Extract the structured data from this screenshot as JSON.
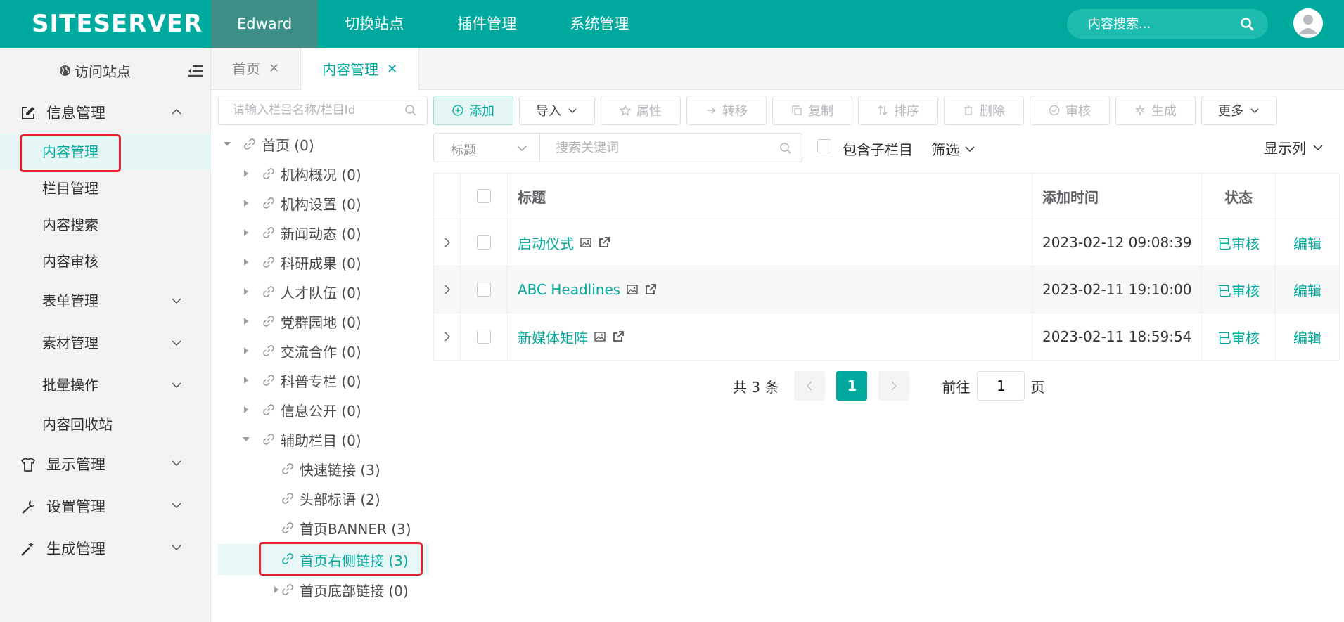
{
  "topbar": {
    "logo": "SITESERVER",
    "nav": [
      "Edward",
      "切换站点",
      "插件管理",
      "系统管理"
    ],
    "search_placeholder": "内容搜索..."
  },
  "sidebar": {
    "visit_site": "访问站点",
    "groups": {
      "info": "信息管理",
      "display": "显示管理",
      "settings": "设置管理",
      "generate": "生成管理"
    },
    "items": {
      "content_manage": "内容管理",
      "channel_manage": "栏目管理",
      "content_search": "内容搜索",
      "content_audit": "内容审核",
      "form_manage": "表单管理",
      "material_manage": "素材管理",
      "batch_ops": "批量操作",
      "recycle": "内容回收站"
    }
  },
  "tabs": [
    "首页",
    "内容管理"
  ],
  "tree": {
    "search_placeholder": "请输入栏目名称/栏目Id",
    "nodes": [
      {
        "label": "首页 (0)"
      },
      {
        "label": "机构概况 (0)"
      },
      {
        "label": "机构设置 (0)"
      },
      {
        "label": "新闻动态 (0)"
      },
      {
        "label": "科研成果 (0)"
      },
      {
        "label": "人才队伍 (0)"
      },
      {
        "label": "党群园地 (0)"
      },
      {
        "label": "交流合作 (0)"
      },
      {
        "label": "科普专栏 (0)"
      },
      {
        "label": "信息公开 (0)"
      },
      {
        "label": "辅助栏目 (0)"
      },
      {
        "label": "快速链接 (3)"
      },
      {
        "label": "头部标语 (2)"
      },
      {
        "label": "首页BANNER (3)"
      },
      {
        "label": "首页右侧链接 (3)"
      },
      {
        "label": "首页底部链接 (0)"
      }
    ]
  },
  "toolbar": {
    "add": "添加",
    "import": "导入",
    "attributes": "属性",
    "transfer": "转移",
    "copy": "复制",
    "sort": "排序",
    "delete": "删除",
    "audit": "审核",
    "generate": "生成",
    "more": "更多"
  },
  "filter": {
    "field_select": "标题",
    "keyword_placeholder": "搜索关键词",
    "include_children": "包含子栏目",
    "screen": "筛选",
    "display_columns": "显示列"
  },
  "table": {
    "headers": {
      "title": "标题",
      "added_time": "添加时间",
      "status": "状态"
    },
    "rows": [
      {
        "title": "启动仪式",
        "time": "2023-02-12 09:08:39",
        "status": "已审核",
        "op": "编辑"
      },
      {
        "title": "ABC Headlines",
        "time": "2023-02-11 19:10:00",
        "status": "已审核",
        "op": "编辑"
      },
      {
        "title": "新媒体矩阵",
        "time": "2023-02-11 18:59:54",
        "status": "已审核",
        "op": "编辑"
      }
    ]
  },
  "pagination": {
    "total": "共 3 条",
    "current_page": "1",
    "goto": "前往",
    "goto_value": "1",
    "page_suffix": "页"
  },
  "colors": {
    "brand": "#00a99d",
    "highlight_box": "#e5202e"
  }
}
